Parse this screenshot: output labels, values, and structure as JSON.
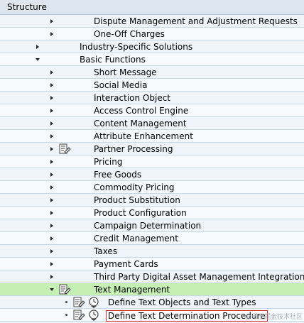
{
  "header": {
    "title": "Structure"
  },
  "rows": [
    {
      "label": "Dispute Management and Adjustment Requests",
      "toggle": "right",
      "indent": 2,
      "icons": []
    },
    {
      "label": "One-Off Charges",
      "toggle": "right",
      "indent": 2,
      "icons": []
    },
    {
      "label": "Industry-Specific Solutions",
      "toggle": "right",
      "indent": 1,
      "icons": []
    },
    {
      "label": "Basic Functions",
      "toggle": "down",
      "indent": 1,
      "icons": []
    },
    {
      "label": "Short Message",
      "toggle": "right",
      "indent": 2,
      "icons": []
    },
    {
      "label": "Social Media",
      "toggle": "right",
      "indent": 2,
      "icons": []
    },
    {
      "label": "Interaction Object",
      "toggle": "right",
      "indent": 2,
      "icons": []
    },
    {
      "label": "Access Control Engine",
      "toggle": "right",
      "indent": 2,
      "icons": []
    },
    {
      "label": "Content Management",
      "toggle": "right",
      "indent": 2,
      "icons": []
    },
    {
      "label": "Attribute Enhancement",
      "toggle": "right",
      "indent": 2,
      "icons": []
    },
    {
      "label": "Partner Processing",
      "toggle": "right",
      "indent": 2,
      "icons": [
        "doc"
      ]
    },
    {
      "label": "Pricing",
      "toggle": "right",
      "indent": 2,
      "icons": []
    },
    {
      "label": "Free Goods",
      "toggle": "right",
      "indent": 2,
      "icons": []
    },
    {
      "label": "Commodity Pricing",
      "toggle": "right",
      "indent": 2,
      "icons": []
    },
    {
      "label": "Product Substitution",
      "toggle": "right",
      "indent": 2,
      "icons": []
    },
    {
      "label": "Product Configuration",
      "toggle": "right",
      "indent": 2,
      "icons": []
    },
    {
      "label": "Campaign Determination",
      "toggle": "right",
      "indent": 2,
      "icons": []
    },
    {
      "label": "Credit Management",
      "toggle": "right",
      "indent": 2,
      "icons": []
    },
    {
      "label": "Taxes",
      "toggle": "right",
      "indent": 2,
      "icons": []
    },
    {
      "label": "Payment Cards",
      "toggle": "right",
      "indent": 2,
      "icons": []
    },
    {
      "label": "Third Party Digital Asset Management Integration",
      "toggle": "right",
      "indent": 2,
      "icons": []
    },
    {
      "label": "Text Management",
      "toggle": "down",
      "indent": 2,
      "icons": [
        "doc"
      ],
      "highlight": true
    },
    {
      "label": "Define Text Objects and Text Types",
      "toggle": "dot",
      "indent": 3,
      "icons": [
        "doc",
        "clock"
      ]
    },
    {
      "label": "Define Text Determination Procedure",
      "toggle": "dot",
      "indent": 3,
      "icons": [
        "doc",
        "clock"
      ],
      "selected": true
    }
  ],
  "watermark": "@稀土掘金技术社区"
}
